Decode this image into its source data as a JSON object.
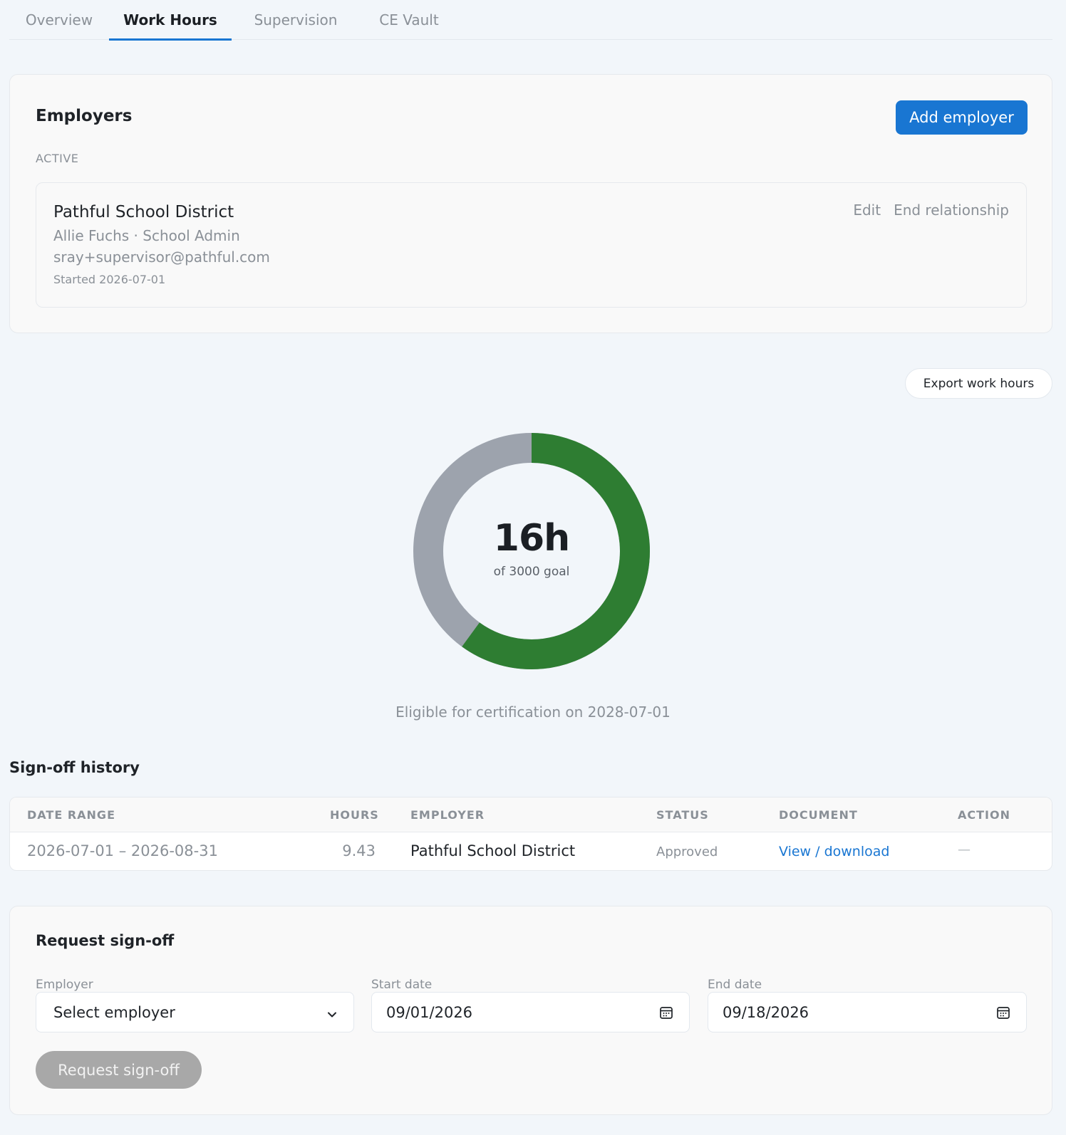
{
  "tabs": [
    {
      "label": "Overview"
    },
    {
      "label": "Work Hours"
    },
    {
      "label": "Supervision"
    },
    {
      "label": "CE Vault"
    }
  ],
  "employers": {
    "title": "Employers",
    "add_button": "Add employer",
    "active_label": "ACTIVE",
    "item": {
      "name": "Pathful School District",
      "supervisor": "Allie Fuchs · School Admin",
      "email": "sray+supervisor@pathful.com",
      "started": "Started 2026-07-01",
      "edit_label": "Edit",
      "end_label": "End relationship"
    }
  },
  "export_button": "Export work hours",
  "progress": {
    "hours_label": "16h",
    "goal_label": "of 3000 goal",
    "ring_fraction": 0.6,
    "eligible_text": "Eligible for certification on 2028-07-01",
    "colors": {
      "filled": "#2e7d32",
      "remaining": "#9da3ad"
    }
  },
  "history": {
    "title": "Sign-off history",
    "columns": [
      "DATE RANGE",
      "HOURS",
      "EMPLOYER",
      "STATUS",
      "DOCUMENT",
      "ACTION"
    ],
    "rows": [
      {
        "date_range": "2026-07-01 – 2026-08-31",
        "hours": "9.43",
        "employer": "Pathful School District",
        "status": "Approved",
        "document": "View / download",
        "action": "—"
      }
    ]
  },
  "request": {
    "title": "Request sign-off",
    "employer_label": "Employer",
    "employer_value": "Select employer",
    "start_label": "Start date",
    "start_value": "09/01/2026",
    "end_label": "End date",
    "end_value": "09/18/2026",
    "submit": "Request sign-off"
  },
  "colors": {
    "accent": "#1976d2",
    "link": "#1976d2"
  }
}
